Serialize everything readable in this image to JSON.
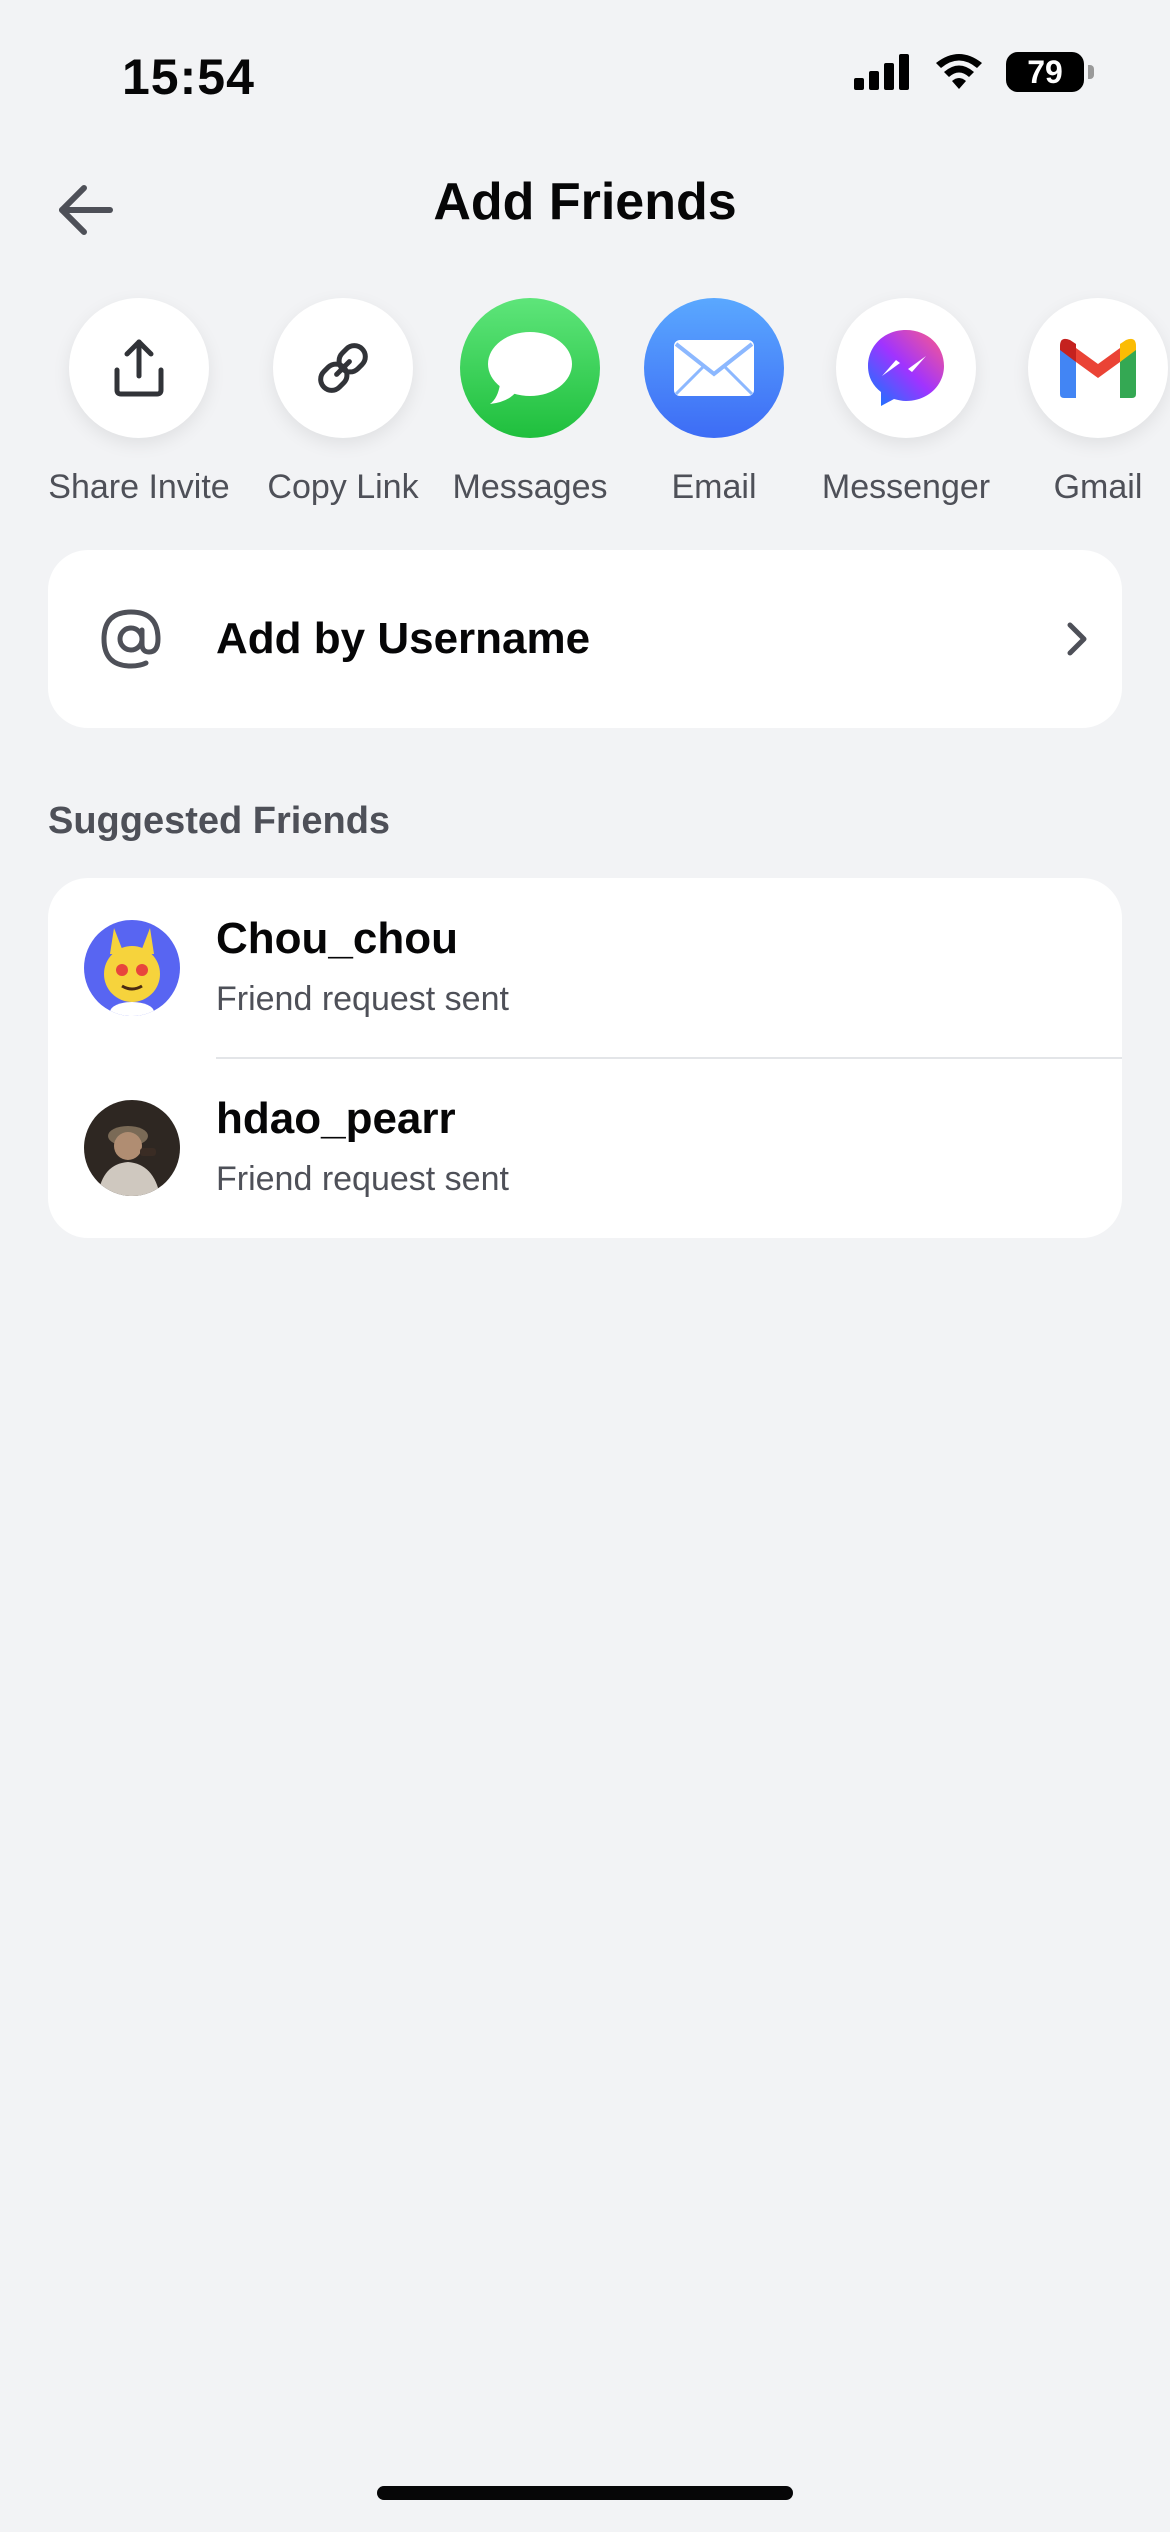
{
  "status_bar": {
    "time": "15:54",
    "battery": "79"
  },
  "header": {
    "title": "Add Friends"
  },
  "share_options": [
    {
      "label": "Share Invite",
      "icon": "share-icon"
    },
    {
      "label": "Copy Link",
      "icon": "link-icon"
    },
    {
      "label": "Messages",
      "icon": "messages-icon"
    },
    {
      "label": "Email",
      "icon": "email-icon"
    },
    {
      "label": "Messenger",
      "icon": "messenger-icon"
    },
    {
      "label": "Gmail",
      "icon": "gmail-icon"
    }
  ],
  "add_by_username": {
    "label": "Add by Username",
    "icon": "at-icon"
  },
  "suggested": {
    "title": "Suggested Friends",
    "friends": [
      {
        "name": "Chou_chou",
        "status": "Friend request sent"
      },
      {
        "name": "hdao_pearr",
        "status": "Friend request sent"
      }
    ]
  },
  "colors": {
    "background": "#f2f3f5",
    "card": "#ffffff",
    "messages_green": "#34c759",
    "email_blue": "#3d8bfd",
    "text_secondary": "#4e5058"
  }
}
